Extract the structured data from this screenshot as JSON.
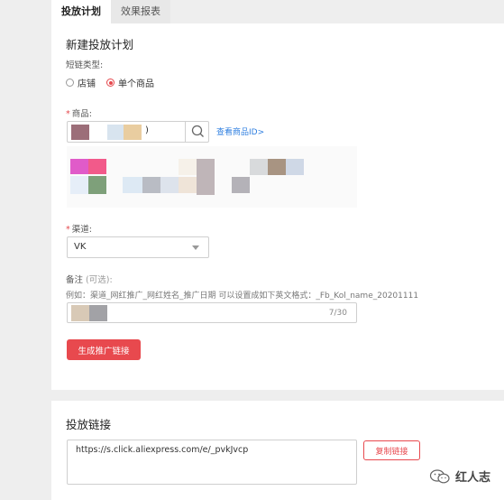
{
  "tabs": [
    {
      "label": "投放计划",
      "active": true
    },
    {
      "label": "效果报表",
      "active": false
    }
  ],
  "form": {
    "title": "新建投放计划",
    "link_type_label": "短链类型:",
    "link_type_options": [
      {
        "label": "店铺",
        "selected": false
      },
      {
        "label": "单个商品",
        "selected": true
      }
    ],
    "product_label": "商品:",
    "product_value_suffix": ")",
    "view_product_id": "查看商品ID>",
    "channel_label": "渠道:",
    "channel_value": "VK",
    "remark_label": "备注",
    "remark_optional": "(可选):",
    "remark_hint": "例如：渠道_网红推广_网红姓名_推广日期 可以设置成如下英文格式：_Fb_Kol_name_20201111",
    "remark_counter": "7/30",
    "generate_button": "生成推广链接"
  },
  "result": {
    "title": "投放链接",
    "link_value": "https://s.click.aliexpress.com/e/_pvkJvcp",
    "copy_button": "复制链接"
  },
  "watermark": {
    "text": "红人志"
  },
  "colors": {
    "accent": "#e8494e",
    "link": "#2f7fe0"
  }
}
